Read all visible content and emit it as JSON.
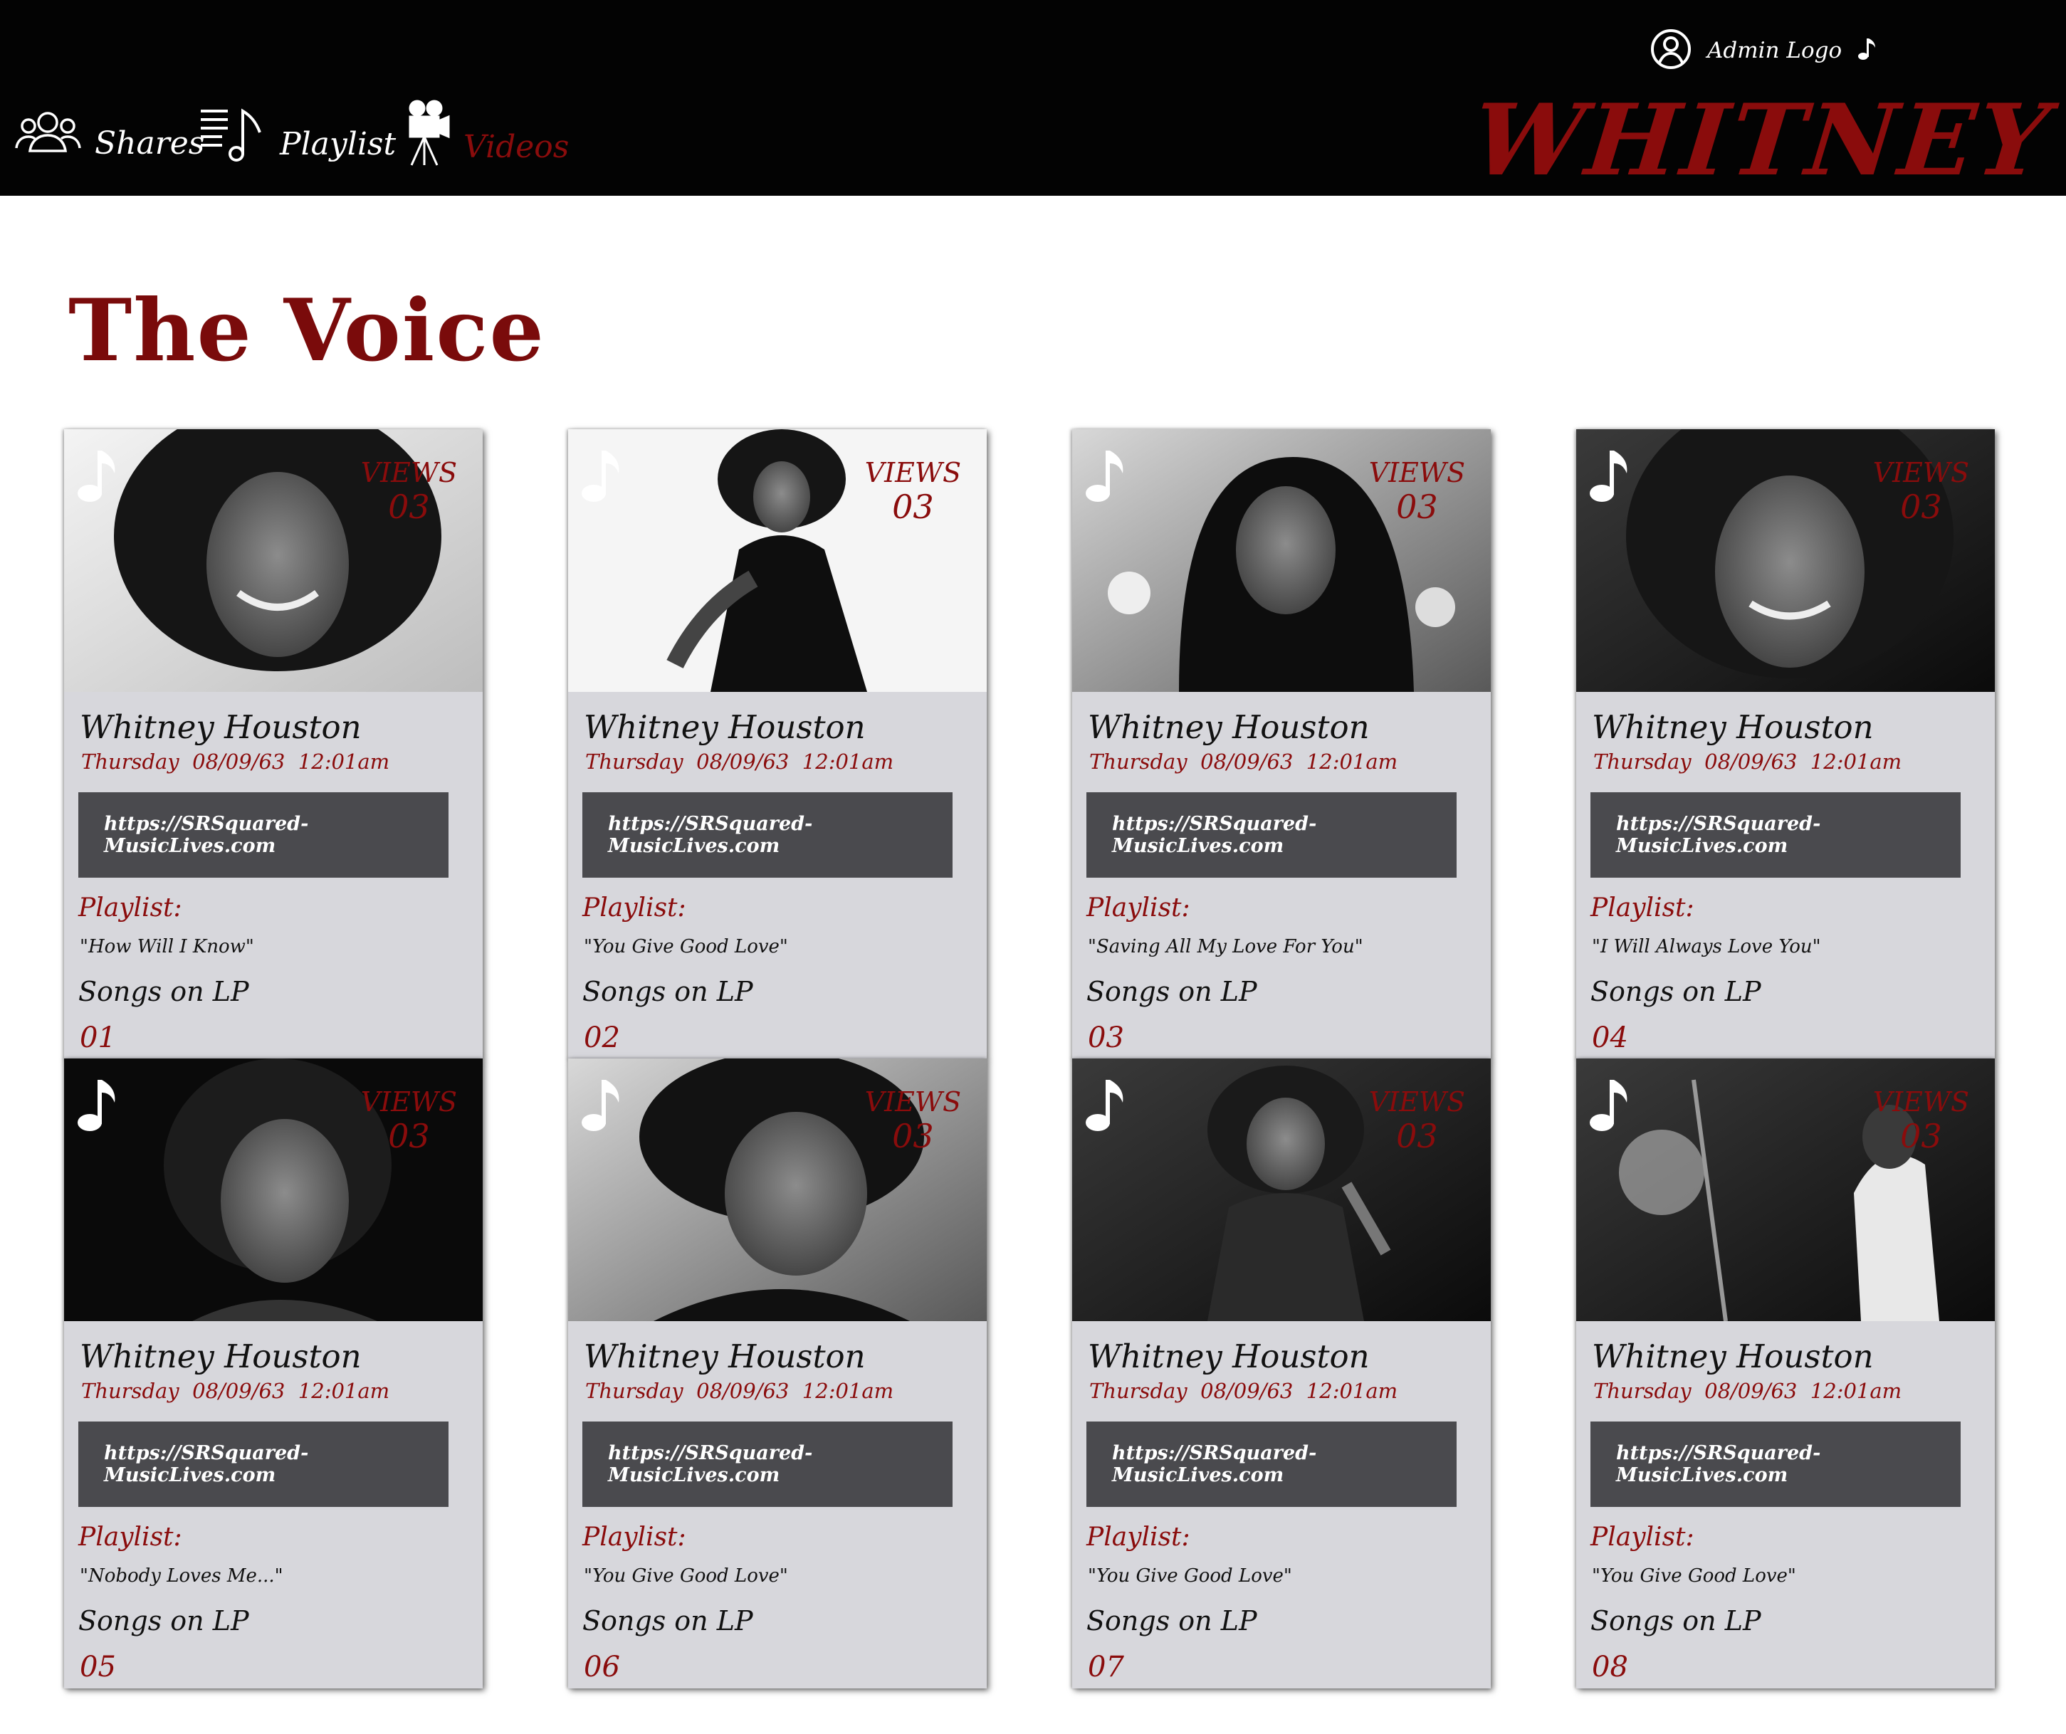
{
  "nav": {
    "items": [
      {
        "label": "Shares",
        "icon": "users-group-icon"
      },
      {
        "label": "Playlist",
        "icon": "playlist-music-icon"
      },
      {
        "label": "Videos",
        "icon": "film-camera-icon"
      }
    ],
    "active": "Videos",
    "admin_label": "Admin Logo",
    "brand": "WHITNEY"
  },
  "page": {
    "title": "The Voice"
  },
  "colors": {
    "accent": "#8a0c0c",
    "header_bg": "#030303",
    "card_bg": "#d7d7dc",
    "url_bg": "#4a4a4e"
  },
  "cards": [
    {
      "views_label": "VIEWS",
      "views": "03",
      "artist": "Whitney Houston",
      "date": "Thursday  08/09/63  12:01am",
      "url": "https://SRSquared-MusicLives.com",
      "playlist_label": "Playlist:",
      "song": "\"How Will I Know\"",
      "lp_label": "Songs on LP",
      "lp_number": "01"
    },
    {
      "views_label": "VIEWS",
      "views": "03",
      "artist": "Whitney Houston",
      "date": "Thursday  08/09/63  12:01am",
      "url": "https://SRSquared-MusicLives.com",
      "playlist_label": "Playlist:",
      "song": "\"You Give Good Love\"",
      "lp_label": "Songs on LP",
      "lp_number": "02"
    },
    {
      "views_label": "VIEWS",
      "views": "03",
      "artist": "Whitney Houston",
      "date": "Thursday  08/09/63  12:01am",
      "url": "https://SRSquared-MusicLives.com",
      "playlist_label": "Playlist:",
      "song": "\"Saving All My Love For You\"",
      "lp_label": "Songs on LP",
      "lp_number": "03"
    },
    {
      "views_label": "VIEWS",
      "views": "03",
      "artist": "Whitney Houston",
      "date": "Thursday  08/09/63  12:01am",
      "url": "https://SRSquared-MusicLives.com",
      "playlist_label": "Playlist:",
      "song": "\"I Will Always Love You\"",
      "lp_label": "Songs on LP",
      "lp_number": "04"
    },
    {
      "views_label": "VIEWS",
      "views": "03",
      "artist": "Whitney Houston",
      "date": "Thursday  08/09/63  12:01am",
      "url": "https://SRSquared-MusicLives.com",
      "playlist_label": "Playlist:",
      "song": "\"Nobody Loves Me...\"",
      "lp_label": "Songs on LP",
      "lp_number": "05"
    },
    {
      "views_label": "VIEWS",
      "views": "03",
      "artist": "Whitney Houston",
      "date": "Thursday  08/09/63  12:01am",
      "url": "https://SRSquared-MusicLives.com",
      "playlist_label": "Playlist:",
      "song": "\"You Give Good Love\"",
      "lp_label": "Songs on LP",
      "lp_number": "06"
    },
    {
      "views_label": "VIEWS",
      "views": "03",
      "artist": "Whitney Houston",
      "date": "Thursday  08/09/63  12:01am",
      "url": "https://SRSquared-MusicLives.com",
      "playlist_label": "Playlist:",
      "song": "\"You Give Good Love\"",
      "lp_label": "Songs on LP",
      "lp_number": "07"
    },
    {
      "views_label": "VIEWS",
      "views": "03",
      "artist": "Whitney Houston",
      "date": "Thursday  08/09/63  12:01am",
      "url": "https://SRSquared-MusicLives.com",
      "playlist_label": "Playlist:",
      "song": "\"You Give Good Love\"",
      "lp_label": "Songs on LP",
      "lp_number": "08"
    }
  ]
}
